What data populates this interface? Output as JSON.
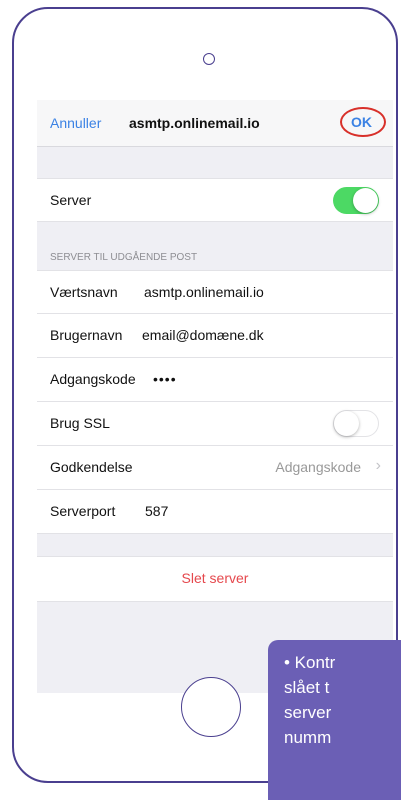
{
  "nav": {
    "cancel_label": "Annuller",
    "title": "asmtp.onlinemail.io",
    "ok_label": "OK"
  },
  "server_row": {
    "label": "Server",
    "toggle_on": true
  },
  "section_header": "SERVER TIL UDGÅENDE POST",
  "fields": [
    {
      "label": "Værtsnavn",
      "value": "asmtp.onlinemail.io"
    },
    {
      "label": "Brugernavn",
      "value": "email@domæne.dk"
    },
    {
      "label": "Adgangskode",
      "value": "••••"
    },
    {
      "label": "Brug SSL",
      "toggle_on": false
    },
    {
      "label": "Godkendelse",
      "value": "Adgangskode"
    },
    {
      "label": "Serverport",
      "value": "587"
    }
  ],
  "delete_label": "Slet server",
  "callout": {
    "text": "•  Kontr\nslået t\nserver\nnumm"
  },
  "colors": {
    "accent_blue": "#3b82e4",
    "toggle_green": "#4cd964",
    "destructive_red": "#e5484d",
    "highlight_ring": "#d8302a",
    "callout_purple": "#6b5fb5",
    "frame_outline": "#4a3f8f"
  },
  "icons": [
    "chevron-right-icon",
    "camera-dot-icon",
    "home-button-icon"
  ]
}
